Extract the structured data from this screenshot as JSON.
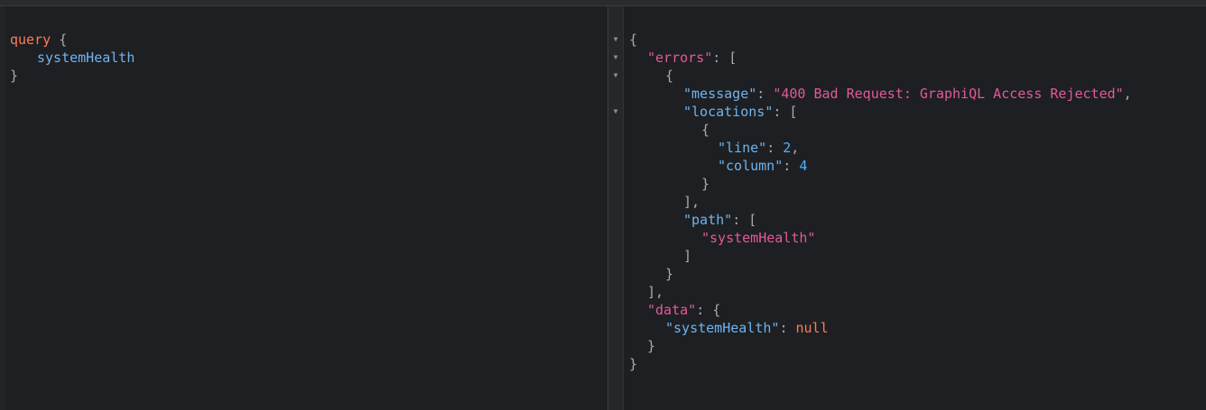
{
  "query_editor": {
    "keyword": "query",
    "open_brace": "{",
    "field": "systemHealth",
    "close_brace": "}"
  },
  "result_viewer": {
    "collapse_icon": "triangle-down-icon",
    "errors_key": "errors",
    "message_key": "message",
    "message_value": "400 Bad Request: GraphiQL Access Rejected",
    "locations_key": "locations",
    "line_key": "line",
    "line_value": "2",
    "column_key": "column",
    "column_value": "4",
    "path_key": "path",
    "path_value": "systemHealth",
    "data_key": "data",
    "system_health_key": "systemHealth",
    "system_health_value": "null"
  },
  "colors": {
    "background": "#1e1f22",
    "keyword": "#ff7b5a",
    "field": "#6eb3f0",
    "string": "#e05a9b",
    "number": "#4db2ff",
    "punctuation": "#a9abaf"
  }
}
